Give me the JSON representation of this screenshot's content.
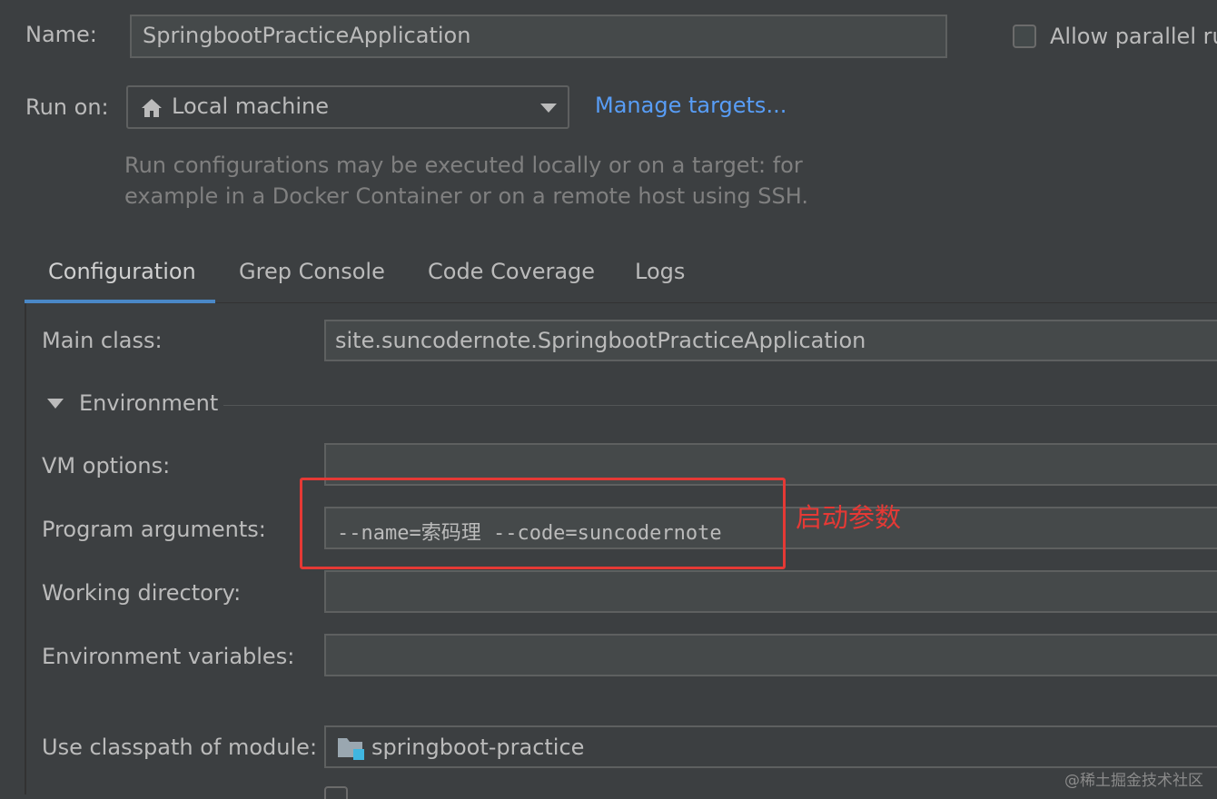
{
  "name": {
    "label": "Name:",
    "value": "SpringbootPracticeApplication"
  },
  "allow_parallel": {
    "label": "Allow parallel ru",
    "checked": false
  },
  "run_on": {
    "label": "Run on:",
    "value": "Local machine",
    "icon": "home-icon",
    "manage_link": "Manage targets..."
  },
  "hint": {
    "line1": "Run configurations may be executed locally or on a target: for",
    "line2": "example in a Docker Container or on a remote host using SSH."
  },
  "tabs": [
    {
      "label": "Configuration",
      "active": true
    },
    {
      "label": "Grep Console",
      "active": false
    },
    {
      "label": "Code Coverage",
      "active": false
    },
    {
      "label": "Logs",
      "active": false
    }
  ],
  "main_class": {
    "label": "Main class:",
    "value": "site.suncodernote.SpringbootPracticeApplication"
  },
  "environment": {
    "label": "Environment",
    "expanded": true
  },
  "vm_options": {
    "label": "VM options:",
    "value": ""
  },
  "program_args": {
    "label": "Program arguments:",
    "value": "--name=索码理 --code=suncodernote"
  },
  "annotation": {
    "text": "启动参数",
    "color": "#e53935"
  },
  "working_dir": {
    "label": "Working directory:",
    "value": ""
  },
  "env_vars": {
    "label": "Environment variables:",
    "value": ""
  },
  "classpath": {
    "label": "Use classpath of module:",
    "value": "springboot-practice",
    "icon": "module-folder-icon"
  },
  "watermark": "@稀土掘金技术社区",
  "colors": {
    "background": "#3c3f41",
    "field_bg": "#45494a",
    "link": "#589df6",
    "tab_underline": "#4a88c7",
    "annotation_red": "#e53935"
  }
}
